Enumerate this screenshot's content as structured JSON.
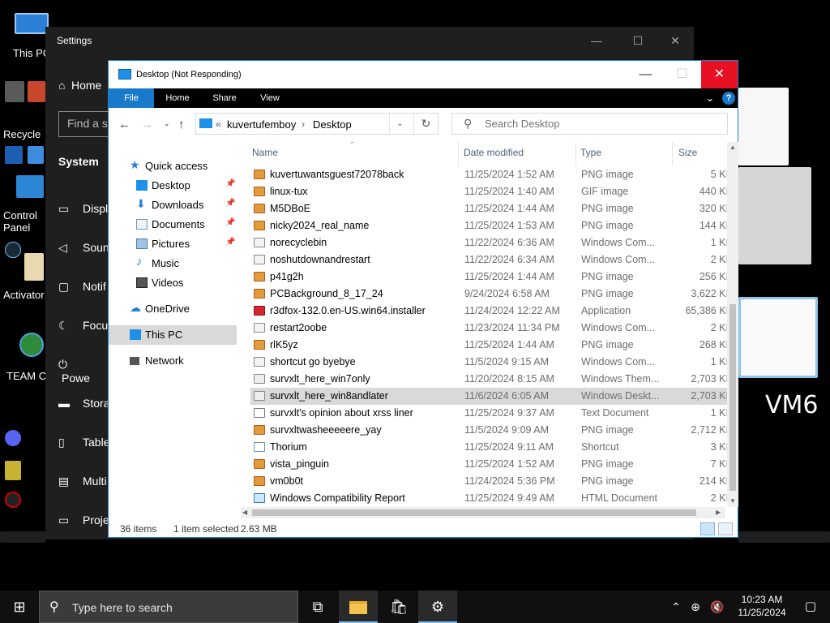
{
  "desktop": {
    "labels": [
      "This PC",
      "Recycle",
      "Control Panel",
      "Activator",
      "TEAM C",
      "VM6"
    ],
    "bg_color": "#000000"
  },
  "settings": {
    "title": "Settings",
    "home": "Home",
    "search_placeholder": "Find a se",
    "section": "System",
    "nav": [
      "Displ",
      "Soun",
      "Notif",
      "Focu",
      "Powe",
      "Stora",
      "Table",
      "Multi",
      "Proje"
    ]
  },
  "explorer": {
    "title": "Desktop (Not Responding)",
    "ribbon_tabs": [
      "File",
      "Home",
      "Share",
      "View"
    ],
    "address": {
      "prefix": "«",
      "crumbs": [
        "kuvertufemboy",
        "Desktop"
      ]
    },
    "search_placeholder": "Search Desktop",
    "nav_pane": {
      "quick_access": "Quick access",
      "pinned": [
        "Desktop",
        "Downloads",
        "Documents",
        "Pictures"
      ],
      "others": [
        "Music",
        "Videos"
      ],
      "onedrive": "OneDrive",
      "this_pc": "This PC",
      "network": "Network"
    },
    "columns": [
      "Name",
      "Date modified",
      "Type",
      "Size"
    ],
    "files": [
      {
        "name": "kuvertuwantsguest72078back",
        "date": "11/25/2024 1:52 AM",
        "type": "PNG image",
        "size": "5 KI",
        "icon": "png"
      },
      {
        "name": "linux-tux",
        "date": "11/25/2024 1:40 AM",
        "type": "GIF image",
        "size": "440 KI",
        "icon": "gif"
      },
      {
        "name": "M5DBoE",
        "date": "11/25/2024 1:44 AM",
        "type": "PNG image",
        "size": "320 KI",
        "icon": "png"
      },
      {
        "name": "nicky2024_real_name",
        "date": "11/25/2024 1:53 AM",
        "type": "PNG image",
        "size": "144 KI",
        "icon": "png"
      },
      {
        "name": "norecyclebin",
        "date": "11/22/2024 6:36 AM",
        "type": "Windows Com...",
        "size": "1 KI",
        "icon": "win"
      },
      {
        "name": "noshutdownandrestart",
        "date": "11/22/2024 6:34 AM",
        "type": "Windows Com...",
        "size": "2 KI",
        "icon": "win"
      },
      {
        "name": "p41g2h",
        "date": "11/25/2024 1:44 AM",
        "type": "PNG image",
        "size": "256 KI",
        "icon": "png"
      },
      {
        "name": "PCBackground_8_17_24",
        "date": "9/24/2024 6:58 AM",
        "type": "PNG image",
        "size": "3,622 KI",
        "icon": "png"
      },
      {
        "name": "r3dfox-132.0.en-US.win64.installer",
        "date": "11/24/2024 12:22 AM",
        "type": "Application",
        "size": "65,386 KI",
        "icon": "app"
      },
      {
        "name": "restart2oobe",
        "date": "11/23/2024 11:34 PM",
        "type": "Windows Com...",
        "size": "2 KI",
        "icon": "win"
      },
      {
        "name": "rlK5yz",
        "date": "11/25/2024 1:44 AM",
        "type": "PNG image",
        "size": "268 KI",
        "icon": "png"
      },
      {
        "name": "shortcut go byebye",
        "date": "11/5/2024 9:15 AM",
        "type": "Windows Com...",
        "size": "1 KI",
        "icon": "win"
      },
      {
        "name": "survxlt_here_win7only",
        "date": "11/20/2024 8:15 AM",
        "type": "Windows Them...",
        "size": "2,703 KI",
        "icon": "theme"
      },
      {
        "name": "survxlt_here_win8andlater",
        "date": "11/6/2024 6:05 AM",
        "type": "Windows Deskt...",
        "size": "2,703 KI",
        "icon": "theme",
        "selected": true
      },
      {
        "name": "survxlt's opinion about xrss liner",
        "date": "11/25/2024 9:37 AM",
        "type": "Text Document",
        "size": "1 KI",
        "icon": "txt"
      },
      {
        "name": "survxltwasheeeeere_yay",
        "date": "11/5/2024 9:09 AM",
        "type": "PNG image",
        "size": "2,712 KI",
        "icon": "png"
      },
      {
        "name": "Thorium",
        "date": "11/25/2024 9:11 AM",
        "type": "Shortcut",
        "size": "3 KI",
        "icon": "sc"
      },
      {
        "name": "vista_pinguin",
        "date": "11/25/2024 1:52 AM",
        "type": "PNG image",
        "size": "7 KI",
        "icon": "png"
      },
      {
        "name": "vm0b0t",
        "date": "11/24/2024 5:36 PM",
        "type": "PNG image",
        "size": "214 KI",
        "icon": "png"
      },
      {
        "name": "Windows Compatibility Report",
        "date": "11/25/2024 9:49 AM",
        "type": "HTML Document",
        "size": "2 KI",
        "icon": "html"
      }
    ],
    "status": {
      "items": "36 items",
      "selected": "1 item selected",
      "size": "2.63 MB"
    },
    "accent": "#1979ca",
    "close_color": "#e81123"
  },
  "taskbar": {
    "search_placeholder": "Type here to search",
    "time": "10:23 AM",
    "date": "11/25/2024"
  }
}
